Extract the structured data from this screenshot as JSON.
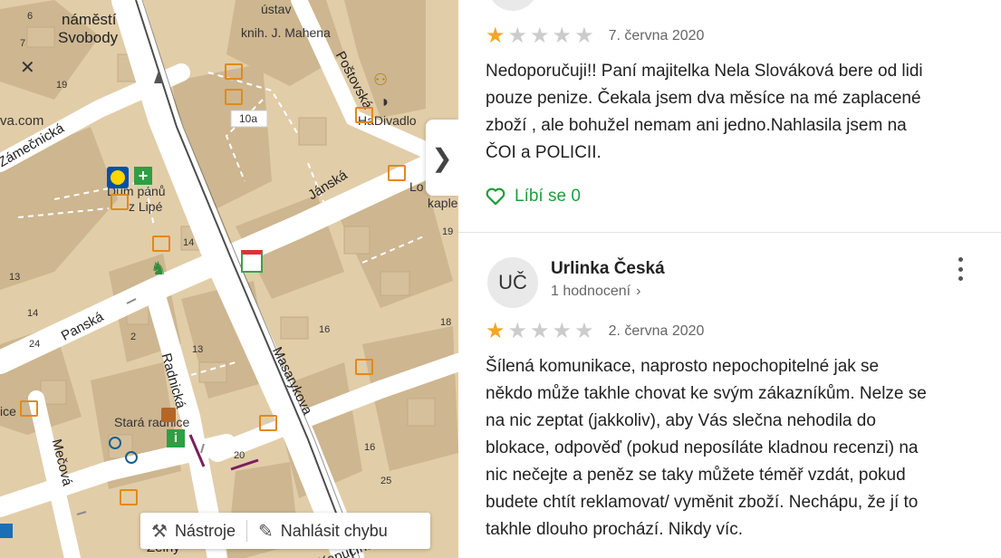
{
  "map": {
    "labels": {
      "namesti": "náměstí",
      "svobody": "Svobody",
      "ustav": "ústav",
      "knih": "knih. J. Mahena",
      "postovska": "Poštovská",
      "hadivadlo": "HaDivadlo",
      "zamecnicka": "Zámečnická",
      "dum_panu": "Dům pánů",
      "lipe": "z Lipé",
      "janska": "Jánská",
      "lo": "Lo",
      "kaple": "kaple",
      "panska": "Panská",
      "radnicka": "Radnická",
      "masarykova": "Masarykova",
      "stara_radnice": "Stará radnice",
      "mecova": "Mečová",
      "zeleny": "Zelný",
      "kapucinska": "Kapucínská",
      "web": "va.com",
      "ice": "ice",
      "badge_10a": "10a"
    },
    "numbers": [
      "6",
      "7",
      "19",
      "14",
      "19",
      "18",
      "16",
      "13",
      "14",
      "2",
      "24",
      "13",
      "20",
      "16",
      "25"
    ],
    "toolbar": {
      "tools": "Nástroje",
      "report": "Nahlásit chybu"
    }
  },
  "reviews": [
    {
      "rating": 1,
      "max": 5,
      "date": "7. června 2020",
      "lines": [
        "Nedoporučuji!! Paní majitelka Nela Slováková bere od lidi",
        "pouze penize. Čekala jsem dva měsíce na mé zaplacené",
        "zboží , ale bohužel nemam ani jedno.Nahlasila jsem na",
        "ČOI a POLICII."
      ],
      "like_label": "Líbí se 0"
    },
    {
      "author": "Urlinka Česká",
      "initials": "UČ",
      "count": "1 hodnocení",
      "rating": 1,
      "max": 5,
      "date": "2. června 2020",
      "lines": [
        "Šílená komunikace, naprosto nepochopitelné jak se",
        "někdo může takhle chovat ke svým zákazníkům. Nelze se",
        "na nic zeptat (jakkoliv), aby Vás slečna nehodila do",
        "blokace, odpověď (pokud neposíláte kladnou recenzi) na",
        "nic nečejte a peněz se taky můžete téměř vzdát, pokud",
        "budete chtít reklamovat/ vyměnit zboží. Nechápu, že jí to",
        "takhle dlouho prochází. Nikdy víc."
      ]
    }
  ],
  "colors": {
    "star_on": "#f5a623",
    "star_off": "#cccccc",
    "like_green": "#1e9e3b"
  }
}
